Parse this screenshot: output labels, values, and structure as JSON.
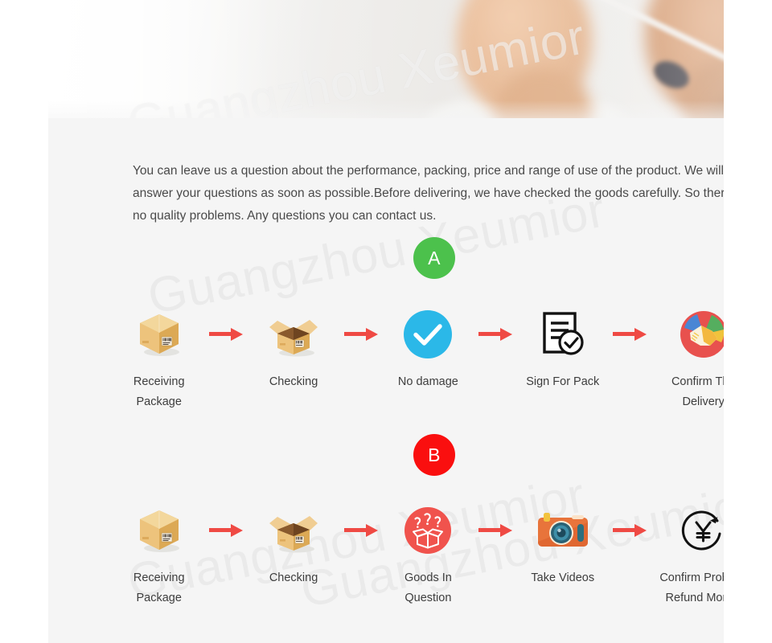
{
  "watermark": {
    "text": "Guangzhou Xeumior",
    "color": "#e9e9e9"
  },
  "hero": {
    "alt": "customer-service-agents-with-headsets-photo",
    "watermark": "Guangzhou Xeumior"
  },
  "intro": {
    "paragraph": "You can leave us a question about the performance, packing, price and range of use of the product. We will answer your questions as soon as possible.Before delivering, we have checked the goods carefully. So there's no quality problems. Any questions you can contact us."
  },
  "sections": [
    {
      "badge": "A",
      "badge_color": "#4cc14c",
      "steps": [
        {
          "icon": "closed-box-icon",
          "label": "Receiving Package"
        },
        {
          "icon": "open-box-icon",
          "label": "Checking"
        },
        {
          "icon": "blue-check-circle-icon",
          "label": "No damage"
        },
        {
          "icon": "signed-document-icon",
          "label": "Sign For Pack"
        },
        {
          "icon": "handshake-circle-icon",
          "label": "Confirm The Delivery"
        }
      ]
    },
    {
      "badge": "B",
      "badge_color": "#fa0f0f",
      "steps": [
        {
          "icon": "closed-box-icon",
          "label": "Receiving Package"
        },
        {
          "icon": "open-box-icon",
          "label": "Checking"
        },
        {
          "icon": "question-box-circle-icon",
          "label": "Goods In Question"
        },
        {
          "icon": "camera-icon",
          "label": "Take Videos"
        },
        {
          "icon": "yen-refund-icon",
          "label": "Confirm Problem\nRefund Money"
        }
      ]
    }
  ],
  "colors": {
    "arrow": "#ef4a44",
    "page_background": "#ffffff",
    "content_background": "#f5f5f5",
    "text": "#3d3d3d",
    "check_circle": "#2bb8e8",
    "question_circle": "#f0534d",
    "camera_body": "#e8743b"
  }
}
